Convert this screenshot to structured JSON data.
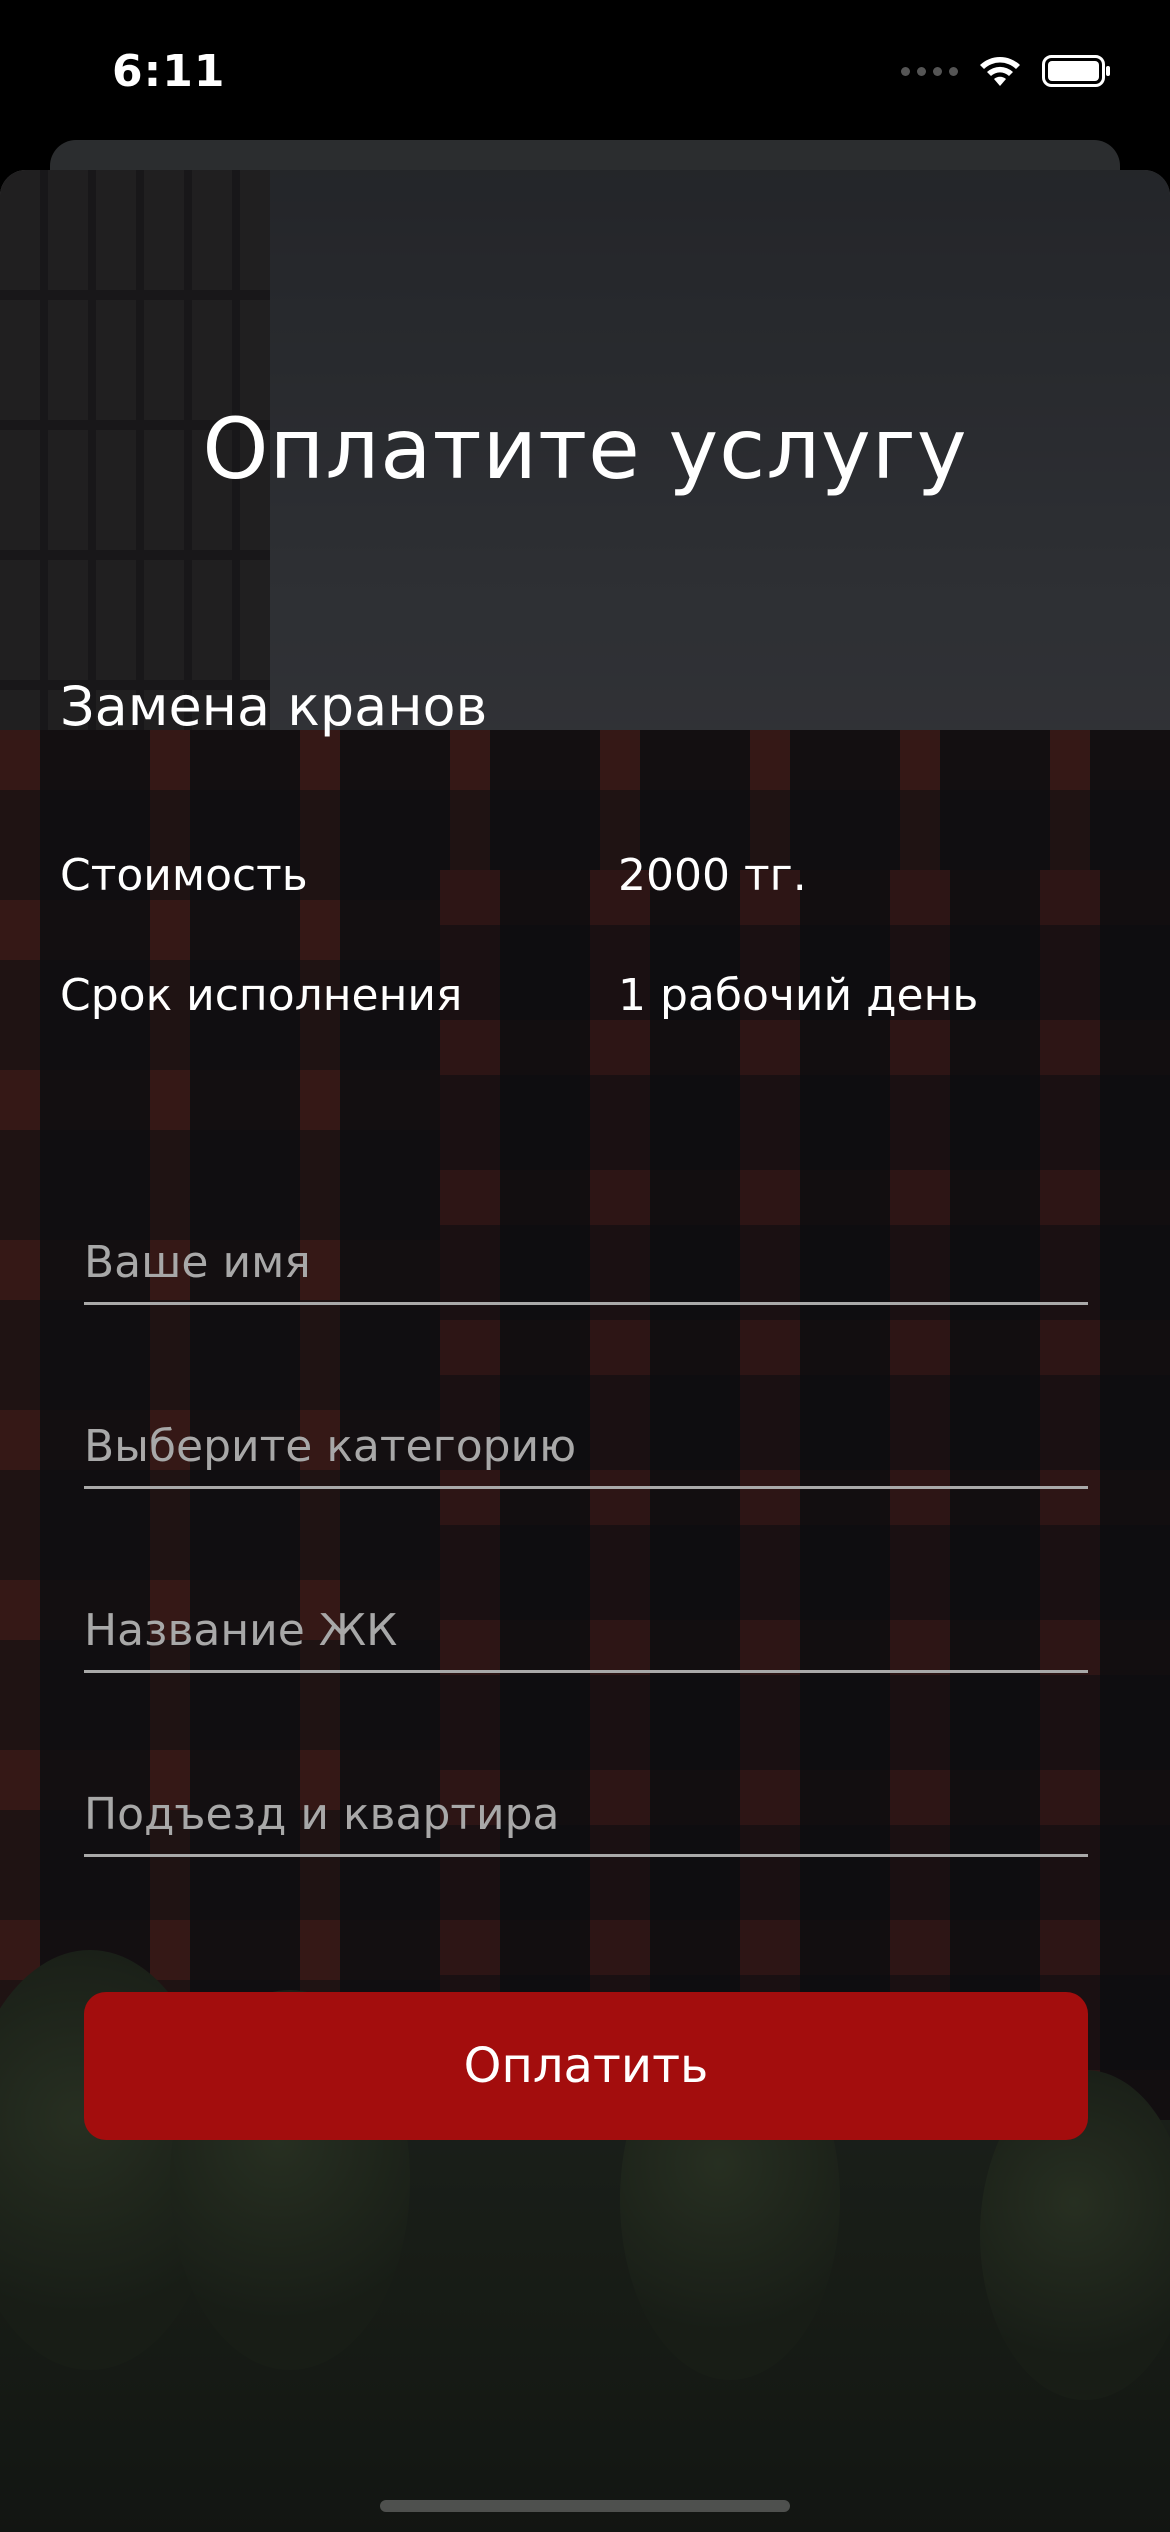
{
  "status_bar": {
    "time": "6:11"
  },
  "page": {
    "title": "Оплатите услугу",
    "service_name": "Замена кранов"
  },
  "info": {
    "cost_label": "Стоимость",
    "cost_value": "2000 тг.",
    "term_label": "Срок исполнения",
    "term_value": "1 рабочий день"
  },
  "form": {
    "name_placeholder": "Ваше имя",
    "category_placeholder": "Выберите категорию",
    "complex_placeholder": "Название ЖК",
    "apartment_placeholder": "Подъезд и квартира",
    "name_value": "",
    "category_value": "",
    "complex_value": "",
    "apartment_value": ""
  },
  "actions": {
    "pay_label": "Оплатить"
  },
  "colors": {
    "accent": "#a30d0d",
    "underline": "#a9a9a9",
    "placeholder": "#a8a8a8"
  },
  "icons": {
    "signal": "cellular-signal-icon",
    "wifi": "wifi-icon",
    "battery": "battery-icon"
  }
}
